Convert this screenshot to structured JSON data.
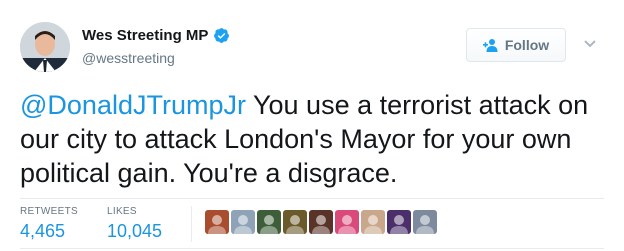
{
  "author": {
    "display_name": "Wes Streeting MP",
    "handle": "@wesstreeting",
    "verified_icon": "verified-badge-icon"
  },
  "follow_button": {
    "label": "Follow",
    "icon": "add-user-icon"
  },
  "more_icon": "chevron-down-icon",
  "tweet": {
    "mention": "@DonaldJTrumpJr",
    "text": " You use a terrorist attack on our city to attack London's Mayor for your own political gain. You're a disgrace."
  },
  "stats": {
    "retweets_label": "RETWEETS",
    "retweets_value": "4,465",
    "likes_label": "LIKES",
    "likes_value": "10,045"
  },
  "liker_avatars": [
    {
      "icon": "liker-avatar-1",
      "color": "#a94d2e"
    },
    {
      "icon": "liker-avatar-2",
      "color": "#8fa3b8"
    },
    {
      "icon": "liker-avatar-3",
      "color": "#3e5e3a"
    },
    {
      "icon": "liker-avatar-4",
      "color": "#6b5a2a"
    },
    {
      "icon": "liker-avatar-5",
      "color": "#5a3328"
    },
    {
      "icon": "liker-avatar-6",
      "color": "#d94a7a"
    },
    {
      "icon": "liker-avatar-7",
      "color": "#c9a78a"
    },
    {
      "icon": "liker-avatar-8",
      "color": "#4a2f6b"
    },
    {
      "icon": "liker-avatar-9",
      "color": "#7d8a9e"
    }
  ],
  "colors": {
    "link": "#1b95e0",
    "verified": "#1da1f2",
    "secondary_text": "#657786"
  }
}
